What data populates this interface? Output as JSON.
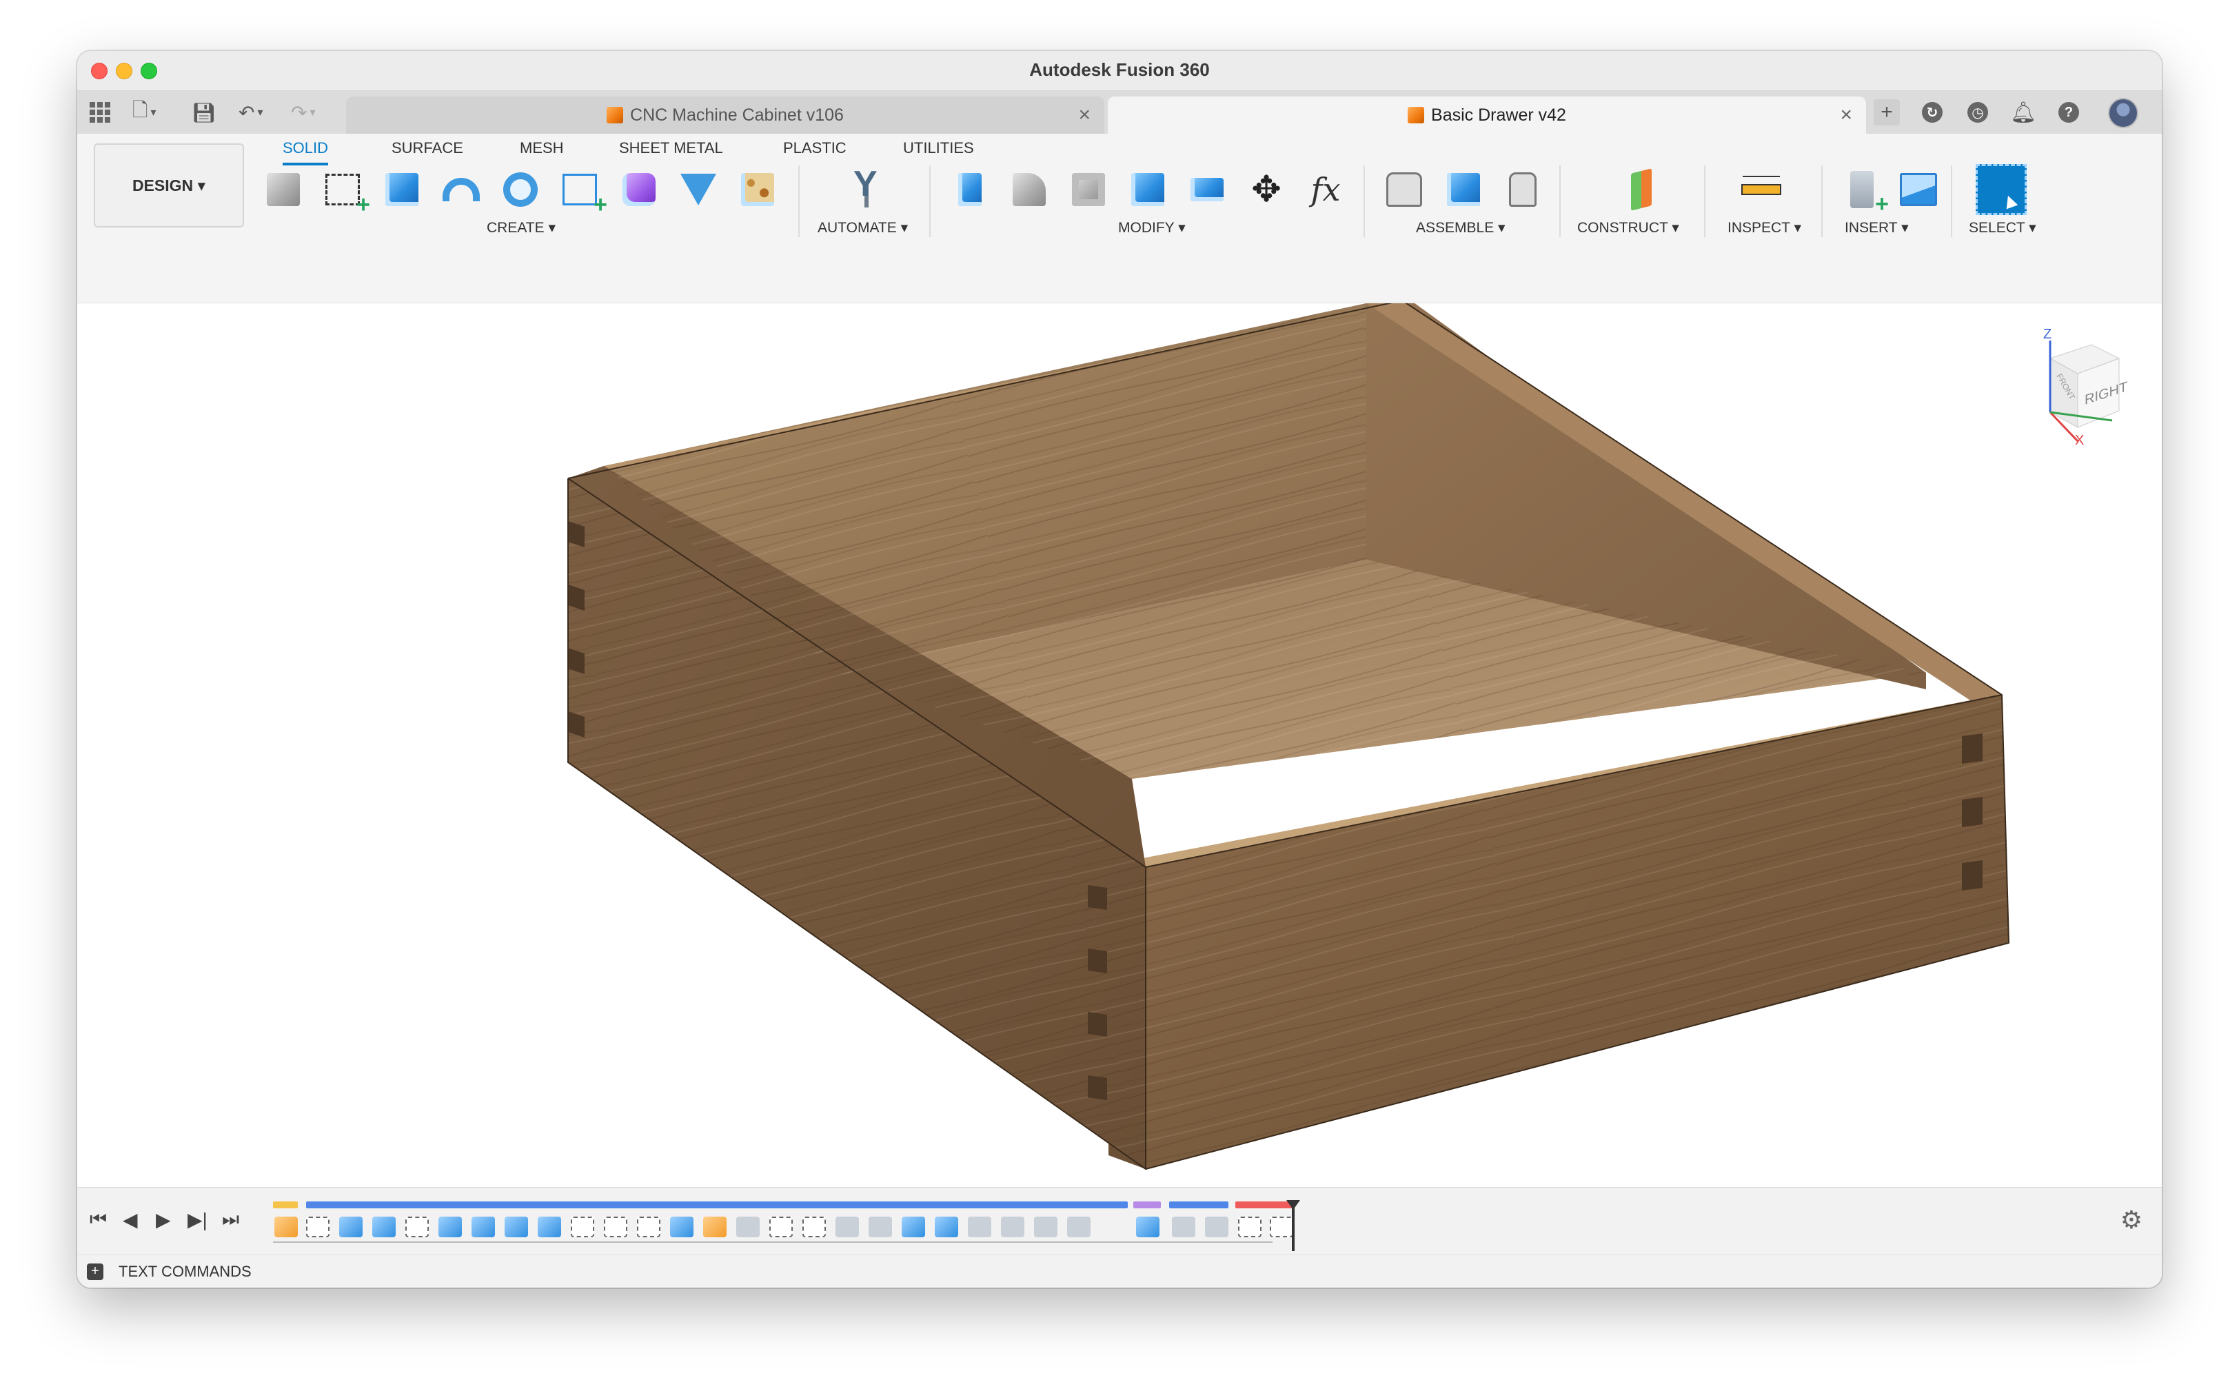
{
  "window": {
    "title": "Autodesk Fusion 360"
  },
  "tabs": [
    {
      "label": "CNC Machine Cabinet v106",
      "active": false
    },
    {
      "label": "Basic Drawer v42",
      "active": true
    }
  ],
  "toolbar": {
    "workspace_button": "DESIGN ▾",
    "workspace_tabs": [
      "SOLID",
      "SURFACE",
      "MESH",
      "SHEET METAL",
      "PLASTIC",
      "UTILITIES"
    ],
    "groups": {
      "create": "CREATE ▾",
      "automate": "AUTOMATE ▾",
      "modify": "MODIFY ▾",
      "assemble": "ASSEMBLE ▾",
      "construct": "CONSTRUCT ▾",
      "inspect": "INSPECT ▾",
      "insert": "INSERT ▾",
      "select": "SELECT ▾"
    }
  },
  "viewcube": {
    "face_front": "FRONT",
    "face_right": "RIGHT",
    "axis_z": "Z",
    "axis_x": "X"
  },
  "bottom": {
    "text_commands": "TEXT COMMANDS"
  },
  "icons": {
    "data_panel": "grid-icon",
    "file": "file-icon",
    "save": "save-icon",
    "undo": "undo-icon",
    "redo": "redo-icon",
    "new_tab": "plus-icon",
    "extensions": "extensions-icon",
    "job_status": "clock-icon",
    "notifications": "bell-icon",
    "help": "help-icon",
    "settings": "gear-icon"
  },
  "colors": {
    "accent": "#0a7dc8",
    "wood": "#8a6a48",
    "tab_active_bg": "#f4f4f4"
  }
}
